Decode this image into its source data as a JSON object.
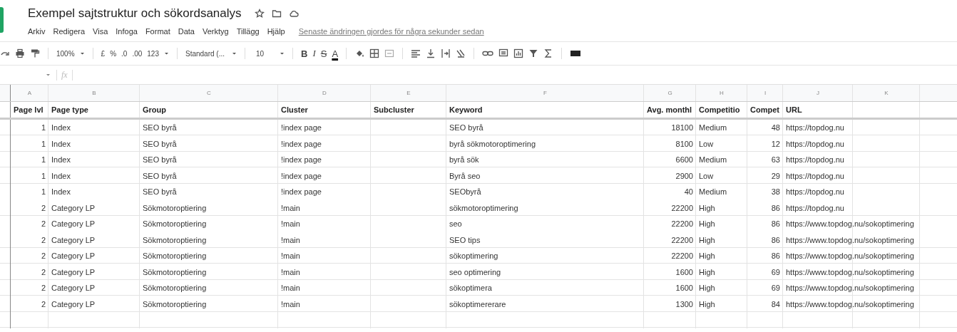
{
  "document": {
    "title": "Exempel sajtstruktur och sökordsanalys"
  },
  "menu": [
    "Arkiv",
    "Redigera",
    "Visa",
    "Infoga",
    "Format",
    "Data",
    "Verktyg",
    "Tillägg",
    "Hjälp"
  ],
  "last_edit": "Senaste ändringen gjordes för några sekunder sedan",
  "toolbar": {
    "zoom": "100%",
    "currency": "£",
    "percent": "%",
    "decimal_less": ".0",
    "decimal_more": ".00",
    "number_format": "123",
    "font": "Standard (...",
    "font_size": "10",
    "bold": "B",
    "italic": "I",
    "strikethrough": "S",
    "text_color": "A"
  },
  "formula_bar": {
    "label": "fx"
  },
  "sheet": {
    "columns": [
      {
        "letter": "A",
        "header": "Page lvl"
      },
      {
        "letter": "B",
        "header": "Page type"
      },
      {
        "letter": "C",
        "header": "Group"
      },
      {
        "letter": "D",
        "header": "Cluster"
      },
      {
        "letter": "E",
        "header": "Subcluster"
      },
      {
        "letter": "F",
        "header": "Keyword"
      },
      {
        "letter": "G",
        "header": "Avg. monthl"
      },
      {
        "letter": "H",
        "header": "Competitio"
      },
      {
        "letter": "I",
        "header": "Compet"
      },
      {
        "letter": "J",
        "header": "URL"
      },
      {
        "letter": "K"
      }
    ],
    "rows": [
      {
        "A": "1",
        "B": "Index",
        "C": "SEO byrå",
        "D": "!index page",
        "F": "SEO byrå",
        "G": "18100",
        "H": "Medium",
        "I": "48",
        "J": "https://topdog.nu"
      },
      {
        "A": "1",
        "B": "Index",
        "C": "SEO byrå",
        "D": "!index page",
        "F": "byrå sökmotoroptimering",
        "G": "8100",
        "H": "Low",
        "I": "12",
        "J": "https://topdog.nu"
      },
      {
        "A": "1",
        "B": "Index",
        "C": "SEO byrå",
        "D": "!index page",
        "F": "byrå sök",
        "G": "6600",
        "H": "Medium",
        "I": "63",
        "J": "https://topdog.nu"
      },
      {
        "A": "1",
        "B": "Index",
        "C": "SEO byrå",
        "D": "!index page",
        "F": "Byrå seo",
        "G": "2900",
        "H": "Low",
        "I": "29",
        "J": "https://topdog.nu"
      },
      {
        "A": "1",
        "B": "Index",
        "C": "SEO byrå",
        "D": "!index page",
        "F": "SEObyrå",
        "G": "40",
        "H": "Medium",
        "I": "38",
        "J": "https://topdog.nu"
      },
      {
        "A": "2",
        "B": "Category LP",
        "C": "Sökmotoroptiering",
        "D": "!main",
        "F": "sökmotoroptimering",
        "G": "22200",
        "H": "High",
        "I": "86",
        "J": "https://topdog.nu"
      },
      {
        "A": "2",
        "B": "Category LP",
        "C": "Sökmotoroptiering",
        "D": "!main",
        "F": "seo",
        "G": "22200",
        "H": "High",
        "I": "86",
        "J": "https://www.topdog.nu/sokoptimering"
      },
      {
        "A": "2",
        "B": "Category LP",
        "C": "Sökmotoroptiering",
        "D": "!main",
        "F": "SEO tips",
        "G": "22200",
        "H": "High",
        "I": "86",
        "J": "https://www.topdog.nu/sokoptimering"
      },
      {
        "A": "2",
        "B": "Category LP",
        "C": "Sökmotoroptiering",
        "D": "!main",
        "F": "sökoptimering",
        "G": "22200",
        "H": "High",
        "I": "86",
        "J": "https://www.topdog.nu/sokoptimering"
      },
      {
        "A": "2",
        "B": "Category LP",
        "C": "Sökmotoroptiering",
        "D": "!main",
        "F": "seo optimering",
        "G": "1600",
        "H": "High",
        "I": "69",
        "J": "https://www.topdog.nu/sokoptimering"
      },
      {
        "A": "2",
        "B": "Category LP",
        "C": "Sökmotoroptiering",
        "D": "!main",
        "F": "sökoptimera",
        "G": "1600",
        "H": "High",
        "I": "69",
        "J": "https://www.topdog.nu/sokoptimering"
      },
      {
        "A": "2",
        "B": "Category LP",
        "C": "Sökmotoroptiering",
        "D": "!main",
        "F": "sökoptimererare",
        "G": "1300",
        "H": "High",
        "I": "84",
        "J": "https://www.topdog.nu/sokoptimering"
      }
    ]
  }
}
